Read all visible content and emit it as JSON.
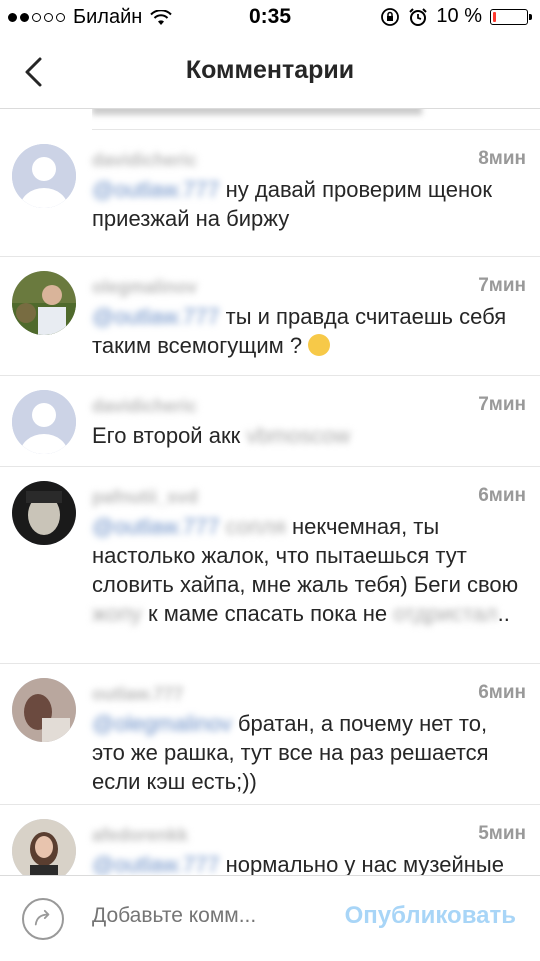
{
  "status": {
    "carrier": "Билайн",
    "time": "0:35",
    "battery_text": "10 %",
    "battery_level": 0.1,
    "signal_icon": "signal-dots-icon",
    "wifi_icon": "wifi-icon",
    "lock_icon": "orientation-lock-icon",
    "alarm_icon": "alarm-icon"
  },
  "header": {
    "title": "Комментарии",
    "back_icon": "chevron-left-icon"
  },
  "comments": [
    {
      "username": "davidicheric",
      "time": "8мин",
      "mention": "@outlaw.777",
      "text": "ну давай проверим щенок приезжай на биржу"
    },
    {
      "username": "olegmalinov",
      "time": "7мин",
      "mention": "@outlaw.777",
      "text": "ты и правда считаешь себя таким всемогущим ?",
      "emoji": "smirk-emoji-icon"
    },
    {
      "username": "davidicheric",
      "time": "7мин",
      "text_prefix": "Его второй акк",
      "blurred_suffix": "vbmoscow"
    },
    {
      "username": "pafnutii_svd",
      "time": "6мин",
      "mention": "@outlaw.777",
      "mention_extra": "сопля",
      "text_a": "некчемная, ты настолько жалок, что пытаешься тут словить хайпа, мне жаль тебя) Беги свою",
      "blurred_mid": "жопу",
      "text_b": "к маме спасать пока не",
      "blurred_end": "отдристал",
      "text_c": ".."
    },
    {
      "username": "outlaw.777",
      "time": "6мин",
      "mention": "@olegmalinov",
      "text": "братан, а почему нет то, это же рашка, тут все на раз решается если кэш есть;))"
    },
    {
      "username": "afedorenkk",
      "time": "5мин",
      "mention": "@outlaw.777",
      "text": "нормально у нас музейные работники Третьяковки"
    }
  ],
  "composer": {
    "placeholder": "Добавьте комм...",
    "publish_label": "Опубликовать",
    "icon": "share-arrow-icon"
  },
  "colors": {
    "mention_blue": "#6b8fc7",
    "publish_disabled": "#a8d5f7",
    "battery_red": "#ff3b30"
  }
}
